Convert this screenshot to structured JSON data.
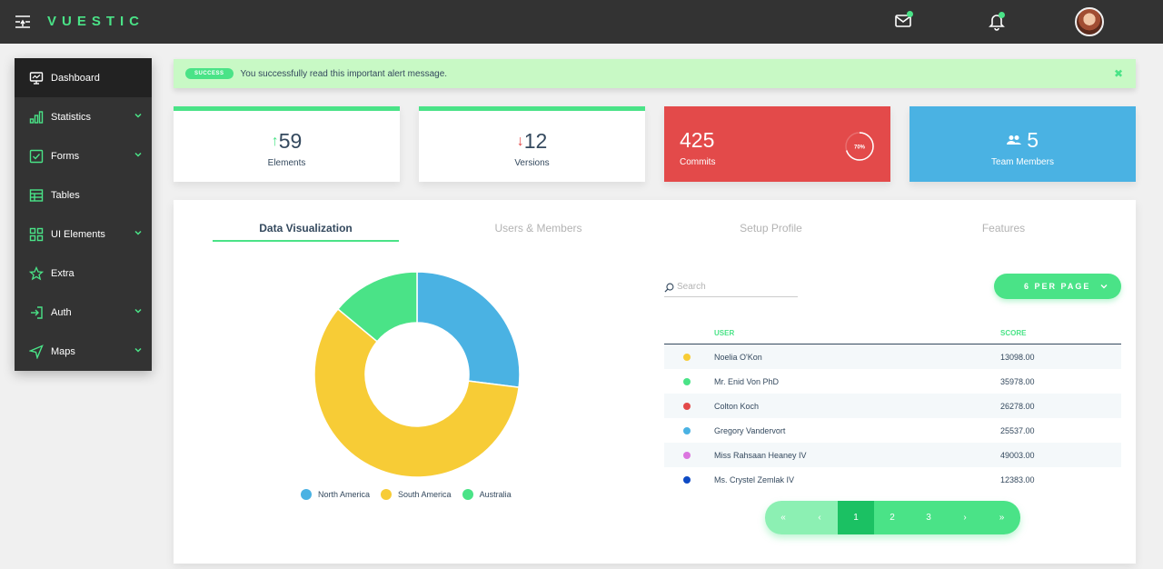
{
  "app": {
    "logo": "VUESTIC"
  },
  "sidebar": {
    "items": [
      {
        "label": "Dashboard",
        "icon": "monitor-icon",
        "active": true,
        "has_children": false
      },
      {
        "label": "Statistics",
        "icon": "bar-chart-icon",
        "active": false,
        "has_children": true
      },
      {
        "label": "Forms",
        "icon": "checkbox-icon",
        "active": false,
        "has_children": true
      },
      {
        "label": "Tables",
        "icon": "table-icon",
        "active": false,
        "has_children": false
      },
      {
        "label": "UI Elements",
        "icon": "grid-icon",
        "active": false,
        "has_children": true
      },
      {
        "label": "Extra",
        "icon": "star-icon",
        "active": false,
        "has_children": false
      },
      {
        "label": "Auth",
        "icon": "login-icon",
        "active": false,
        "has_children": true
      },
      {
        "label": "Maps",
        "icon": "navigation-icon",
        "active": false,
        "has_children": true
      }
    ]
  },
  "alert": {
    "badge": "SUCCESS",
    "message": "You successfully read this important alert message.",
    "close": "✖"
  },
  "cards": {
    "elements": {
      "value": "59",
      "label": "Elements",
      "arrow": "↑"
    },
    "versions": {
      "value": "12",
      "label": "Versions",
      "arrow": "↓"
    },
    "commits": {
      "value": "425",
      "label": "Commits",
      "progress_label": "70%",
      "progress": 0.7
    },
    "team": {
      "value": "5",
      "label": "Team Members"
    }
  },
  "tabs": [
    {
      "label": "Data Visualization",
      "active": true
    },
    {
      "label": "Users & Members",
      "active": false
    },
    {
      "label": "Setup Profile",
      "active": false
    },
    {
      "label": "Features",
      "active": false
    }
  ],
  "chart_data": {
    "type": "pie",
    "donut": true,
    "categories": [
      "North America",
      "South America",
      "Australia"
    ],
    "values": [
      27,
      59,
      14
    ],
    "colors": [
      "#4ab2e3",
      "#f7cc36",
      "#4ae387"
    ],
    "legend": "bottom"
  },
  "table": {
    "search_placeholder": "Search",
    "per_page_label": "6 PER PAGE",
    "headers": {
      "user": "USER",
      "score": "SCORE"
    },
    "rows": [
      {
        "name": "Noelia O'Kon",
        "score": "13098.00",
        "color": "#f7cc36"
      },
      {
        "name": "Mr. Enid Von PhD",
        "score": "35978.00",
        "color": "#4ae387"
      },
      {
        "name": "Colton Koch",
        "score": "26278.00",
        "color": "#e34a4a"
      },
      {
        "name": "Gregory Vandervort",
        "score": "25537.00",
        "color": "#4ab2e3"
      },
      {
        "name": "Miss Rahsaan Heaney IV",
        "score": "49003.00",
        "color": "#db76df"
      },
      {
        "name": "Ms. Crystel Zemlak IV",
        "score": "12383.00",
        "color": "#0e4ac4"
      }
    ]
  },
  "pagination": {
    "first": "«",
    "prev": "‹",
    "pages": [
      "1",
      "2",
      "3"
    ],
    "next": "›",
    "last": "»",
    "current": "1"
  },
  "colors": {
    "accent": "#4ae387",
    "danger": "#e34a4a",
    "info": "#4ab2e3",
    "dark": "#333333"
  }
}
